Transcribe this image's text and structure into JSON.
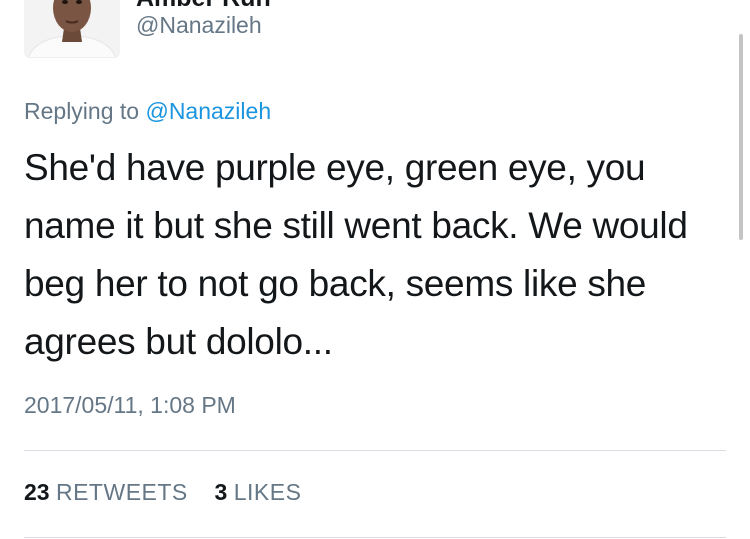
{
  "tweet": {
    "display_name": "Amber Ruh",
    "handle": "@Nanazileh",
    "replying_prefix": "Replying to",
    "replying_to": "@Nanazileh",
    "text": "She'd have purple eye, green eye, you name it but she still went back. We would beg her to not go back, seems like she agrees but dololo...",
    "timestamp": "2017/05/11, 1:08 PM"
  },
  "stats": {
    "retweets_count": "23",
    "retweets_label": "RETWEETS",
    "likes_count": "3",
    "likes_label": "LIKES"
  },
  "icons": {
    "menu": "chevron-down-icon"
  },
  "colors": {
    "text": "#14171a",
    "secondary": "#657786",
    "link": "#1b95e0",
    "divider": "#d8dee3"
  }
}
